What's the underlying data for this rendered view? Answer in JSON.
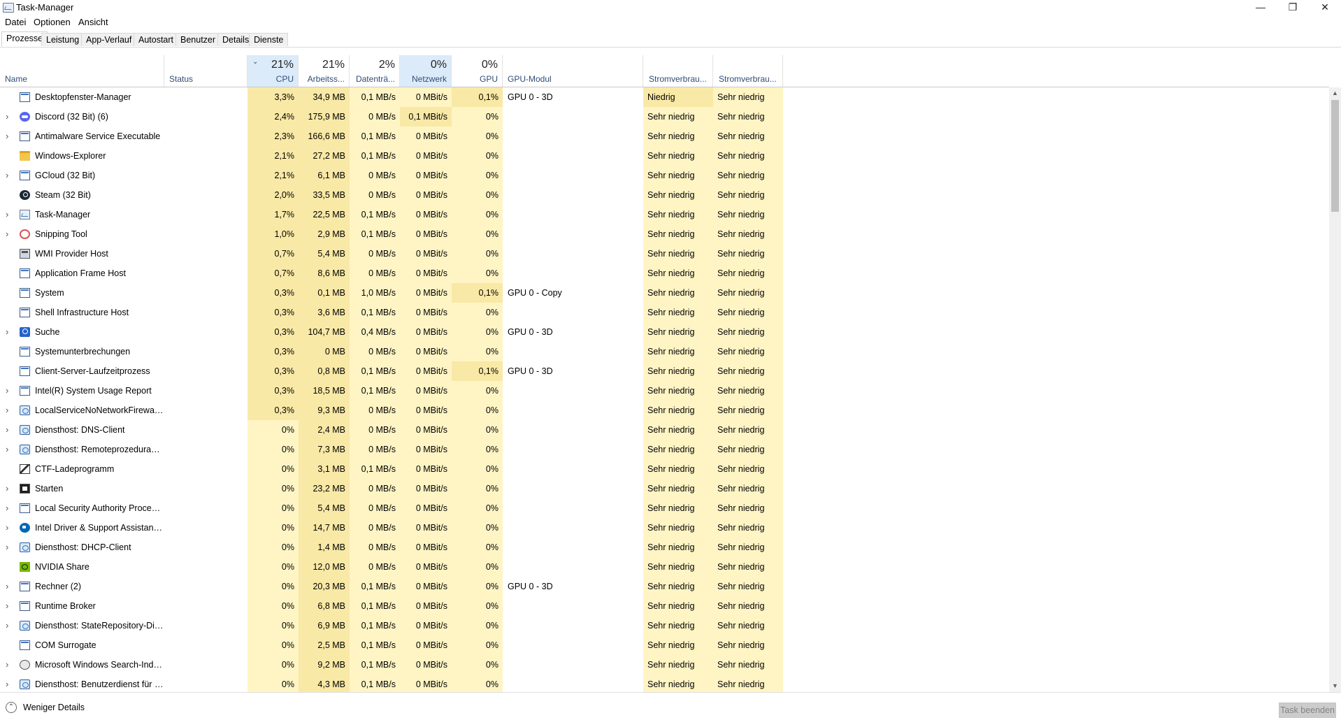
{
  "window": {
    "title": "Task-Manager",
    "buttons": {
      "minimize": "—",
      "restore": "❐",
      "close": "✕"
    }
  },
  "menu": [
    "Datei",
    "Optionen",
    "Ansicht"
  ],
  "tabs": [
    "Prozesse",
    "Leistung",
    "App-Verlauf",
    "Autostart",
    "Benutzer",
    "Details",
    "Dienste"
  ],
  "active_tab": "Prozesse",
  "header": {
    "name": "Name",
    "status": "Status",
    "cpu": {
      "pct": "21%",
      "label": "CPU"
    },
    "mem": {
      "pct": "21%",
      "label": "Arbeitss..."
    },
    "disk": {
      "pct": "2%",
      "label": "Datenträ..."
    },
    "net": {
      "pct": "0%",
      "label": "Netzwerk"
    },
    "gpu": {
      "pct": "0%",
      "label": "GPU"
    },
    "gpu_engine": "GPU-Modul",
    "power": "Stromverbrau...",
    "power_trend": "Stromverbrau..."
  },
  "processes": [
    {
      "name": "Desktopfenster-Manager",
      "icon": "window-icon",
      "expand": false,
      "cpu": "3,3%",
      "mem": "34,9 MB",
      "disk": "0,1 MB/s",
      "net": "0 MBit/s",
      "gpu": "0,1%",
      "engine": "GPU 0 - 3D",
      "power": "Niedrig",
      "trend": "Sehr niedrig"
    },
    {
      "name": "Discord (32 Bit) (6)",
      "icon": "discord-icon",
      "expand": true,
      "cpu": "2,4%",
      "mem": "175,9 MB",
      "disk": "0 MB/s",
      "net": "0,1 MBit/s",
      "gpu": "0%",
      "engine": "",
      "power": "Sehr niedrig",
      "trend": "Sehr niedrig"
    },
    {
      "name": "Antimalware Service Executable",
      "icon": "window-icon",
      "expand": true,
      "cpu": "2,3%",
      "mem": "166,6 MB",
      "disk": "0,1 MB/s",
      "net": "0 MBit/s",
      "gpu": "0%",
      "engine": "",
      "power": "Sehr niedrig",
      "trend": "Sehr niedrig"
    },
    {
      "name": "Windows-Explorer",
      "icon": "folder-icon",
      "expand": false,
      "cpu": "2,1%",
      "mem": "27,2 MB",
      "disk": "0,1 MB/s",
      "net": "0 MBit/s",
      "gpu": "0%",
      "engine": "",
      "power": "Sehr niedrig",
      "trend": "Sehr niedrig"
    },
    {
      "name": "GCloud (32 Bit)",
      "icon": "window-icon",
      "expand": true,
      "cpu": "2,1%",
      "mem": "6,1 MB",
      "disk": "0 MB/s",
      "net": "0 MBit/s",
      "gpu": "0%",
      "engine": "",
      "power": "Sehr niedrig",
      "trend": "Sehr niedrig"
    },
    {
      "name": "Steam (32 Bit)",
      "icon": "steam-icon",
      "expand": false,
      "cpu": "2,0%",
      "mem": "33,5 MB",
      "disk": "0 MB/s",
      "net": "0 MBit/s",
      "gpu": "0%",
      "engine": "",
      "power": "Sehr niedrig",
      "trend": "Sehr niedrig"
    },
    {
      "name": "Task-Manager",
      "icon": "taskmgr-icon",
      "expand": true,
      "cpu": "1,7%",
      "mem": "22,5 MB",
      "disk": "0,1 MB/s",
      "net": "0 MBit/s",
      "gpu": "0%",
      "engine": "",
      "power": "Sehr niedrig",
      "trend": "Sehr niedrig"
    },
    {
      "name": "Snipping Tool",
      "icon": "snip-icon",
      "expand": true,
      "cpu": "1,0%",
      "mem": "2,9 MB",
      "disk": "0,1 MB/s",
      "net": "0 MBit/s",
      "gpu": "0%",
      "engine": "",
      "power": "Sehr niedrig",
      "trend": "Sehr niedrig"
    },
    {
      "name": "WMI Provider Host",
      "icon": "wmi-icon",
      "expand": false,
      "cpu": "0,7%",
      "mem": "5,4 MB",
      "disk": "0 MB/s",
      "net": "0 MBit/s",
      "gpu": "0%",
      "engine": "",
      "power": "Sehr niedrig",
      "trend": "Sehr niedrig"
    },
    {
      "name": "Application Frame Host",
      "icon": "window-icon",
      "expand": false,
      "cpu": "0,7%",
      "mem": "8,6 MB",
      "disk": "0 MB/s",
      "net": "0 MBit/s",
      "gpu": "0%",
      "engine": "",
      "power": "Sehr niedrig",
      "trend": "Sehr niedrig"
    },
    {
      "name": "System",
      "icon": "window-icon",
      "expand": false,
      "cpu": "0,3%",
      "mem": "0,1 MB",
      "disk": "1,0 MB/s",
      "net": "0 MBit/s",
      "gpu": "0,1%",
      "engine": "GPU 0 - Copy",
      "power": "Sehr niedrig",
      "trend": "Sehr niedrig"
    },
    {
      "name": "Shell Infrastructure Host",
      "icon": "window-icon",
      "expand": false,
      "cpu": "0,3%",
      "mem": "3,6 MB",
      "disk": "0,1 MB/s",
      "net": "0 MBit/s",
      "gpu": "0%",
      "engine": "",
      "power": "Sehr niedrig",
      "trend": "Sehr niedrig"
    },
    {
      "name": "Suche",
      "icon": "search-icon",
      "expand": true,
      "cpu": "0,3%",
      "mem": "104,7 MB",
      "disk": "0,4 MB/s",
      "net": "0 MBit/s",
      "gpu": "0%",
      "engine": "GPU 0 - 3D",
      "power": "Sehr niedrig",
      "trend": "Sehr niedrig"
    },
    {
      "name": "Systemunterbrechungen",
      "icon": "window-icon",
      "expand": false,
      "cpu": "0,3%",
      "mem": "0 MB",
      "disk": "0 MB/s",
      "net": "0 MBit/s",
      "gpu": "0%",
      "engine": "",
      "power": "Sehr niedrig",
      "trend": "Sehr niedrig"
    },
    {
      "name": "Client-Server-Laufzeitprozess",
      "icon": "window-icon",
      "expand": false,
      "cpu": "0,3%",
      "mem": "0,8 MB",
      "disk": "0,1 MB/s",
      "net": "0 MBit/s",
      "gpu": "0,1%",
      "engine": "GPU 0 - 3D",
      "power": "Sehr niedrig",
      "trend": "Sehr niedrig"
    },
    {
      "name": "Intel(R) System Usage Report",
      "icon": "window-icon",
      "expand": true,
      "cpu": "0,3%",
      "mem": "18,5 MB",
      "disk": "0,1 MB/s",
      "net": "0 MBit/s",
      "gpu": "0%",
      "engine": "",
      "power": "Sehr niedrig",
      "trend": "Sehr niedrig"
    },
    {
      "name": "LocalServiceNoNetworkFirewall ...",
      "icon": "gear-icon",
      "expand": true,
      "cpu": "0,3%",
      "mem": "9,3 MB",
      "disk": "0 MB/s",
      "net": "0 MBit/s",
      "gpu": "0%",
      "engine": "",
      "power": "Sehr niedrig",
      "trend": "Sehr niedrig"
    },
    {
      "name": "Diensthost: DNS-Client",
      "icon": "gear-icon",
      "expand": true,
      "cpu": "0%",
      "mem": "2,4 MB",
      "disk": "0 MB/s",
      "net": "0 MBit/s",
      "gpu": "0%",
      "engine": "",
      "power": "Sehr niedrig",
      "trend": "Sehr niedrig"
    },
    {
      "name": "Diensthost: Remoteprozeduraufr...",
      "icon": "gear-icon",
      "expand": true,
      "cpu": "0%",
      "mem": "7,3 MB",
      "disk": "0 MB/s",
      "net": "0 MBit/s",
      "gpu": "0%",
      "engine": "",
      "power": "Sehr niedrig",
      "trend": "Sehr niedrig"
    },
    {
      "name": "CTF-Ladeprogramm",
      "icon": "pen-icon",
      "expand": false,
      "cpu": "0%",
      "mem": "3,1 MB",
      "disk": "0,1 MB/s",
      "net": "0 MBit/s",
      "gpu": "0%",
      "engine": "",
      "power": "Sehr niedrig",
      "trend": "Sehr niedrig"
    },
    {
      "name": "Starten",
      "icon": "start-icon",
      "expand": true,
      "cpu": "0%",
      "mem": "23,2 MB",
      "disk": "0 MB/s",
      "net": "0 MBit/s",
      "gpu": "0%",
      "engine": "",
      "power": "Sehr niedrig",
      "trend": "Sehr niedrig"
    },
    {
      "name": "Local Security Authority Process...",
      "icon": "window-icon",
      "expand": true,
      "cpu": "0%",
      "mem": "5,4 MB",
      "disk": "0 MB/s",
      "net": "0 MBit/s",
      "gpu": "0%",
      "engine": "",
      "power": "Sehr niedrig",
      "trend": "Sehr niedrig"
    },
    {
      "name": "Intel Driver & Support Assistant ...",
      "icon": "intel-icon",
      "expand": true,
      "cpu": "0%",
      "mem": "14,7 MB",
      "disk": "0 MB/s",
      "net": "0 MBit/s",
      "gpu": "0%",
      "engine": "",
      "power": "Sehr niedrig",
      "trend": "Sehr niedrig"
    },
    {
      "name": "Diensthost: DHCP-Client",
      "icon": "gear-icon",
      "expand": true,
      "cpu": "0%",
      "mem": "1,4 MB",
      "disk": "0 MB/s",
      "net": "0 MBit/s",
      "gpu": "0%",
      "engine": "",
      "power": "Sehr niedrig",
      "trend": "Sehr niedrig"
    },
    {
      "name": "NVIDIA Share",
      "icon": "nvidia-icon",
      "expand": false,
      "cpu": "0%",
      "mem": "12,0 MB",
      "disk": "0 MB/s",
      "net": "0 MBit/s",
      "gpu": "0%",
      "engine": "",
      "power": "Sehr niedrig",
      "trend": "Sehr niedrig"
    },
    {
      "name": "Rechner (2)",
      "icon": "window-icon",
      "expand": true,
      "cpu": "0%",
      "mem": "20,3 MB",
      "disk": "0,1 MB/s",
      "net": "0 MBit/s",
      "gpu": "0%",
      "engine": "GPU 0 - 3D",
      "power": "Sehr niedrig",
      "trend": "Sehr niedrig"
    },
    {
      "name": "Runtime Broker",
      "icon": "window-icon",
      "expand": true,
      "cpu": "0%",
      "mem": "6,8 MB",
      "disk": "0,1 MB/s",
      "net": "0 MBit/s",
      "gpu": "0%",
      "engine": "",
      "power": "Sehr niedrig",
      "trend": "Sehr niedrig"
    },
    {
      "name": "Diensthost: StateRepository-Die...",
      "icon": "gear-icon",
      "expand": true,
      "cpu": "0%",
      "mem": "6,9 MB",
      "disk": "0,1 MB/s",
      "net": "0 MBit/s",
      "gpu": "0%",
      "engine": "",
      "power": "Sehr niedrig",
      "trend": "Sehr niedrig"
    },
    {
      "name": "COM Surrogate",
      "icon": "window-icon",
      "expand": false,
      "cpu": "0%",
      "mem": "2,5 MB",
      "disk": "0,1 MB/s",
      "net": "0 MBit/s",
      "gpu": "0%",
      "engine": "",
      "power": "Sehr niedrig",
      "trend": "Sehr niedrig"
    },
    {
      "name": "Microsoft Windows Search-Inde...",
      "icon": "user-icon",
      "expand": true,
      "cpu": "0%",
      "mem": "9,2 MB",
      "disk": "0,1 MB/s",
      "net": "0 MBit/s",
      "gpu": "0%",
      "engine": "",
      "power": "Sehr niedrig",
      "trend": "Sehr niedrig"
    },
    {
      "name": "Diensthost: Benutzerdienst für d...",
      "icon": "gear-icon",
      "expand": true,
      "cpu": "0%",
      "mem": "4,3 MB",
      "disk": "0,1 MB/s",
      "net": "0 MBit/s",
      "gpu": "0%",
      "engine": "",
      "power": "Sehr niedrig",
      "trend": "Sehr niedrig"
    }
  ],
  "footer": {
    "fewer_details": "Weniger Details",
    "end_task": "Task beenden"
  },
  "colors": {
    "heat_high": "#f9e9a6",
    "heat_low": "#fff4c4",
    "header_selected": "#dcebf9",
    "header_label": "#2f4d77"
  }
}
